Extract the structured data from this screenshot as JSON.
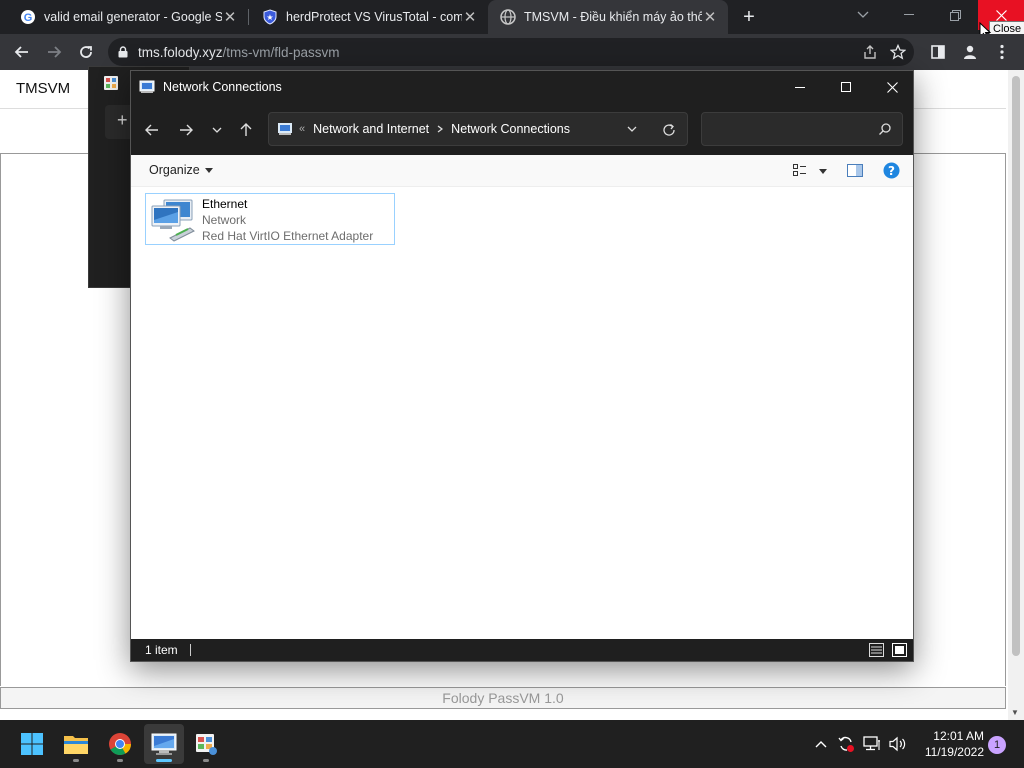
{
  "browser": {
    "tabs": [
      {
        "title": "valid email generator - Google S",
        "icon": "google-icon",
        "active": false
      },
      {
        "title": "herdProtect VS VirusTotal - comp",
        "icon": "shield-icon",
        "active": false
      },
      {
        "title": "TMSVM - Điều khiển máy ảo thô",
        "icon": "globe-icon",
        "active": true
      }
    ],
    "tooltip": "Close",
    "url_host": "tms.folody.xyz",
    "url_path": "/tms-vm/fld-passvm"
  },
  "page": {
    "brand": "TMSVM",
    "footer": "Folody PassVM 1.0"
  },
  "explorer": {
    "title": "Network Connections",
    "breadcrumb": {
      "overflow": "«",
      "items": [
        "Network and Internet",
        "Network Connections"
      ]
    },
    "search_placeholder": "",
    "organize_label": "Organize",
    "items": [
      {
        "name": "Ethernet",
        "status": "Network",
        "adapter": "Red Hat VirtIO Ethernet Adapter"
      }
    ],
    "status_count": "1 item"
  },
  "taskbar": {
    "apps": [
      "start-icon",
      "file-explorer-icon",
      "chrome-icon",
      "network-connections-icon",
      "control-panel-icon"
    ],
    "time": "12:01 AM",
    "date": "11/19/2022",
    "notification_count": "1"
  },
  "colors": {
    "accent": "#5ec7ff",
    "close_red": "#e81123",
    "selection_border": "#99d1ff"
  }
}
